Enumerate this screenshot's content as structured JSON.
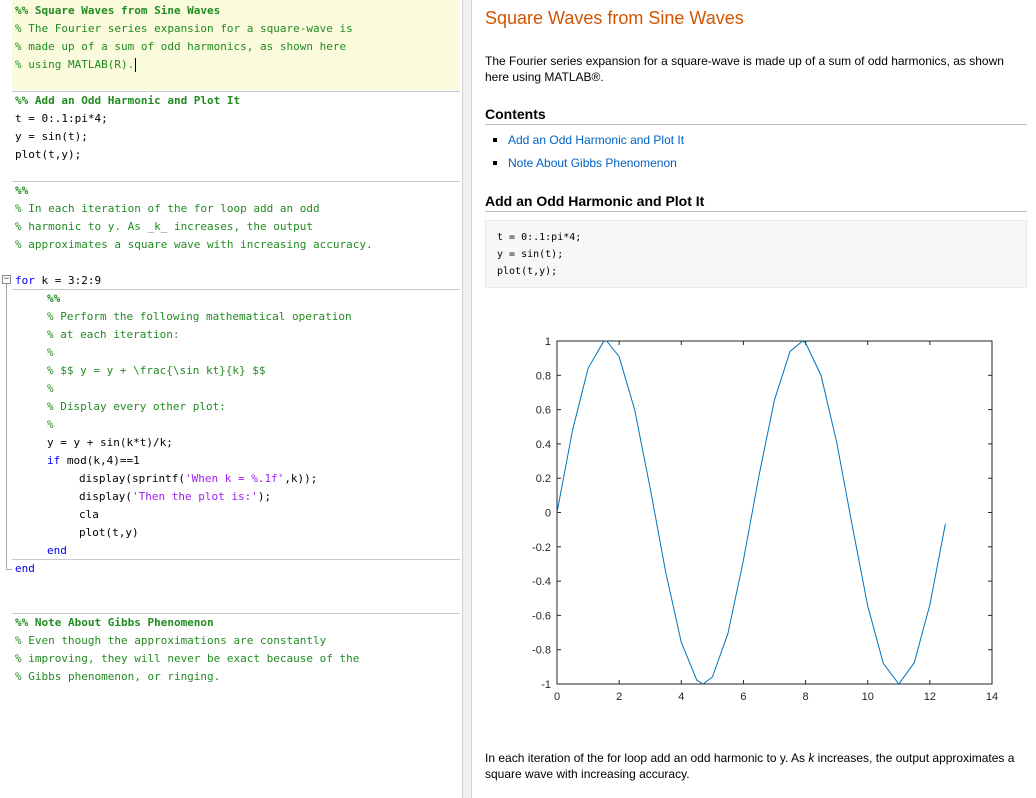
{
  "editor": {
    "lines": {
      "l1": "%% Square Waves from Sine Waves",
      "l2": "% The Fourier series expansion for a square-wave is",
      "l3": "% made up of a sum of odd harmonics, as shown here",
      "l4": "% using MATLAB(R).",
      "l6": "%% Add an Odd Harmonic and Plot It",
      "l7": "t = 0:.1:pi*4;",
      "l8": "y = sin(t);",
      "l9": "plot(t,y);",
      "l11": "%%",
      "l12": "% In each iteration of the for loop add an odd",
      "l13": "% harmonic to y. As _k_ increases, the output",
      "l14": "% approximates a square wave with increasing accuracy.",
      "l16_kw": "for",
      "l16_rest": " k = 3:2:9",
      "l17": "%%",
      "l18": "% Perform the following mathematical operation",
      "l19": "% at each iteration:",
      "l20": "%",
      "l21": "% $$ y = y + \\frac{\\sin kt}{k} $$",
      "l22": "%",
      "l23": "% Display every other plot:",
      "l24": "%",
      "l25": "y = y + sin(k*t)/k;",
      "l26_kw": "if",
      "l26_rest": " mod(k,4)==1",
      "l27_a": "display(sprintf(",
      "l27_s": "'When k = %.1f'",
      "l27_b": ",k));",
      "l28_a": "display(",
      "l28_s": "'Then the plot is:'",
      "l28_b": ");",
      "l29": "cla",
      "l30": "plot(t,y)",
      "l31": "end",
      "l32": "end",
      "l35": "%% Note About Gibbs Phenomenon",
      "l36": "% Even though the approximations are constantly",
      "l37": "% improving, they will never be exact because of the",
      "l38": "% Gibbs phenomenon, or ringing."
    },
    "fold_symbol": "−"
  },
  "output": {
    "title": "Square Waves from Sine Waves",
    "intro": "The Fourier series expansion for a square-wave is made up of a sum of odd harmonics, as shown here using MATLAB®.",
    "contents_heading": "Contents",
    "toc": [
      "Add an Odd Harmonic and Plot It",
      "Note About Gibbs Phenomenon"
    ],
    "section1_heading": "Add an Odd Harmonic and Plot It",
    "code": [
      "t = 0:.1:pi*4;",
      "y = sin(t);",
      "plot(t,y);"
    ],
    "bottom_text": "In each iteration of the for loop add an odd harmonic to y. As k increases, the output approximates a square wave with increasing accuracy.",
    "colors": {
      "title": "#d35400",
      "link": "#0061c6",
      "line": "#0072bd"
    }
  },
  "chart_data": {
    "type": "line",
    "function": "y = sin(t), t = 0:0.1:4*pi",
    "x_range": [
      0,
      12.566
    ],
    "xlim": [
      0,
      14
    ],
    "ylim": [
      -1,
      1
    ],
    "xticks": [
      0,
      2,
      4,
      6,
      8,
      10,
      12,
      14
    ],
    "yticks": [
      -1,
      -0.8,
      -0.6,
      -0.4,
      -0.2,
      0,
      0.2,
      0.4,
      0.6,
      0.8,
      1
    ],
    "xticklabels": [
      "0",
      "2",
      "4",
      "6",
      "8",
      "10",
      "12",
      "14"
    ],
    "yticklabels": [
      "-1",
      "-0.8",
      "-0.6",
      "-0.4",
      "-0.2",
      "0",
      "0.2",
      "0.4",
      "0.6",
      "0.8",
      "1"
    ],
    "series": [
      {
        "x": [
          0,
          0.5,
          1,
          1.5,
          1.6,
          2,
          2.5,
          3,
          3.5,
          4,
          4.5,
          4.7,
          5,
          5.5,
          6,
          6.5,
          7,
          7.5,
          7.9,
          8,
          8.5,
          9,
          9.5,
          10,
          10.5,
          11,
          11.5,
          12,
          12.5
        ],
        "y": [
          0,
          0.479,
          0.841,
          0.997,
          1.0,
          0.909,
          0.598,
          0.141,
          -0.351,
          -0.757,
          -0.978,
          -1.0,
          -0.959,
          -0.706,
          -0.279,
          0.215,
          0.657,
          0.938,
          1.0,
          0.989,
          0.798,
          0.412,
          -0.075,
          -0.544,
          -0.88,
          -1.0,
          -0.875,
          -0.537,
          -0.066
        ]
      }
    ],
    "grid": false,
    "legend": "none"
  }
}
